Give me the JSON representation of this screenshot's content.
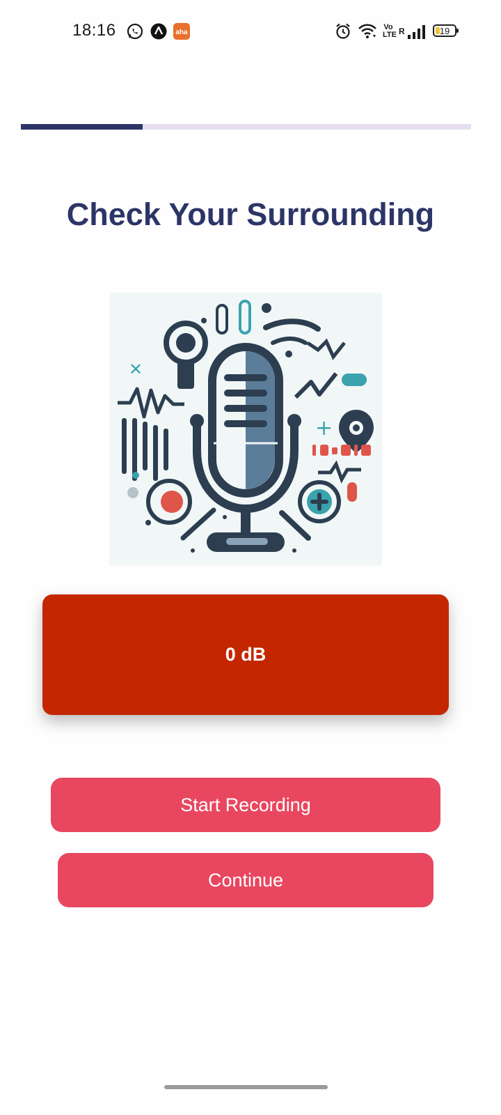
{
  "status_bar": {
    "time": "18:16",
    "left_icons": [
      "whatsapp-icon",
      "navigation-app-icon",
      "aha-app-icon"
    ],
    "aha_label": "aha",
    "right_icons": [
      "alarm-icon",
      "wifi-icon",
      "volte-icon",
      "signal-icon"
    ],
    "volte_label": "Vo LTE",
    "roaming_label": "R",
    "battery_level": "19"
  },
  "progress": {
    "fraction": 0.27,
    "fill_color": "#2c3566",
    "track_color": "#e6e0ee"
  },
  "page": {
    "title": "Check Your Surrounding"
  },
  "illustration": {
    "name": "microphone-illustration"
  },
  "meter": {
    "reading": "0 dB",
    "color": "#c42700"
  },
  "actions": {
    "start_label": "Start Recording",
    "continue_label": "Continue",
    "button_color": "#e94760"
  },
  "colors": {
    "title": "#2c3566",
    "background": "#fefefe"
  }
}
